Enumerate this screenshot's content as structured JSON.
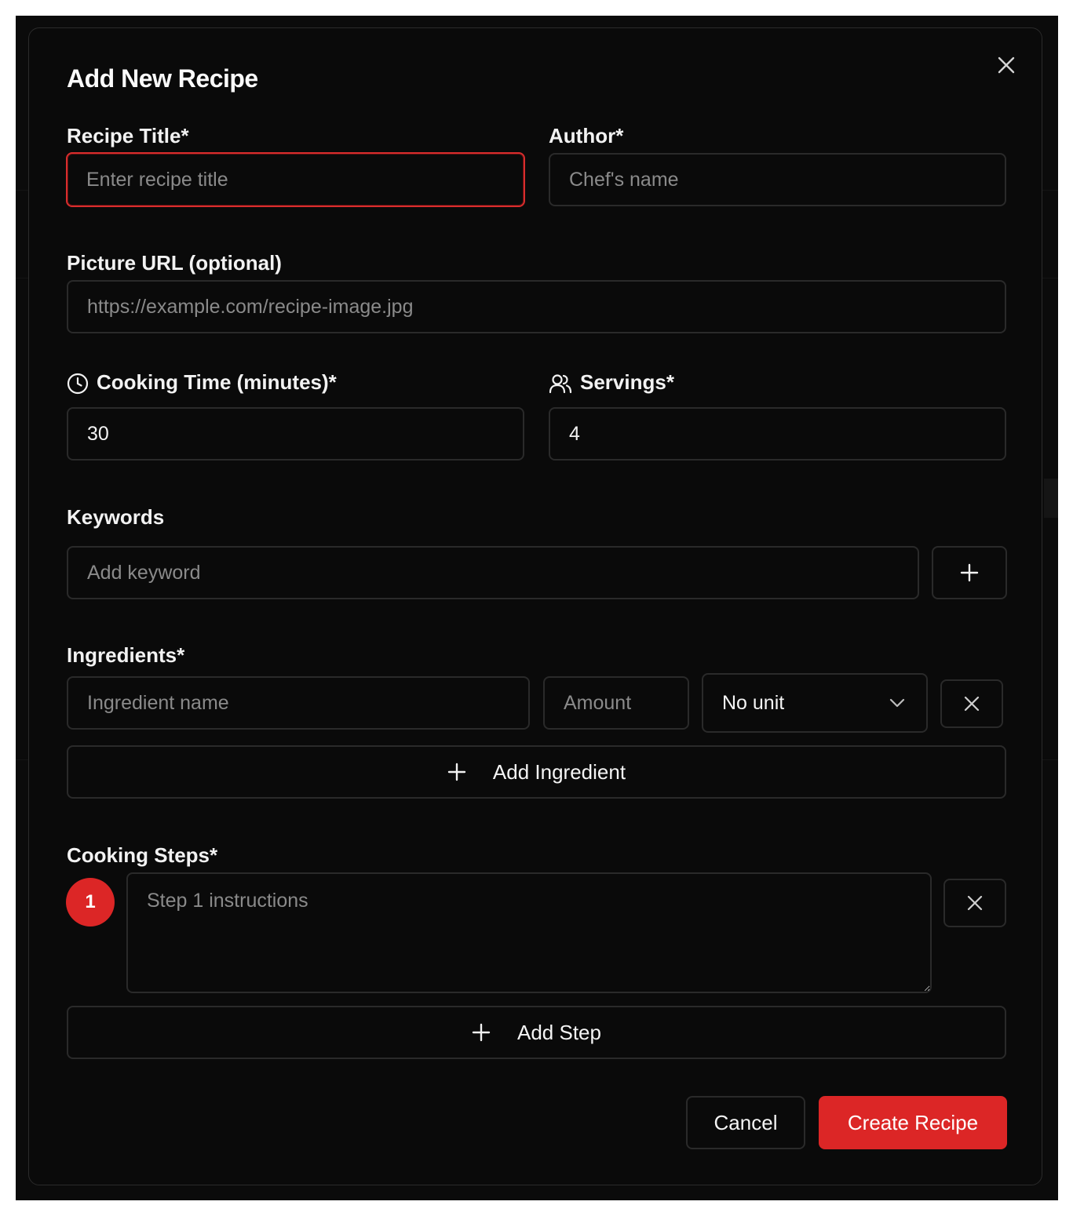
{
  "dialog": {
    "title": "Add New Recipe",
    "close_icon": "close-icon"
  },
  "form": {
    "recipe_title": {
      "label": "Recipe Title*",
      "placeholder": "Enter recipe title",
      "value": ""
    },
    "author": {
      "label": "Author*",
      "placeholder": "Chef's name",
      "value": ""
    },
    "picture_url": {
      "label": "Picture URL (optional)",
      "placeholder": "https://example.com/recipe-image.jpg",
      "value": ""
    },
    "cooking_time": {
      "label": "Cooking Time (minutes)*",
      "icon": "clock-icon",
      "value": "30"
    },
    "servings": {
      "label": "Servings*",
      "icon": "users-icon",
      "value": "4"
    },
    "keywords": {
      "label": "Keywords",
      "placeholder": "Add keyword",
      "add_icon": "plus-icon"
    },
    "ingredients": {
      "label": "Ingredients*",
      "rows": [
        {
          "name_placeholder": "Ingredient name",
          "amount_placeholder": "Amount",
          "unit": "No unit"
        }
      ],
      "add_label": "Add Ingredient"
    },
    "steps": {
      "label": "Cooking Steps*",
      "rows": [
        {
          "number": "1",
          "placeholder": "Step 1 instructions"
        }
      ],
      "add_label": "Add Step"
    }
  },
  "actions": {
    "cancel": "Cancel",
    "submit": "Create Recipe"
  },
  "colors": {
    "accent": "#dc2626",
    "background": "#0a0a0a",
    "border": "#2a2a2a"
  }
}
